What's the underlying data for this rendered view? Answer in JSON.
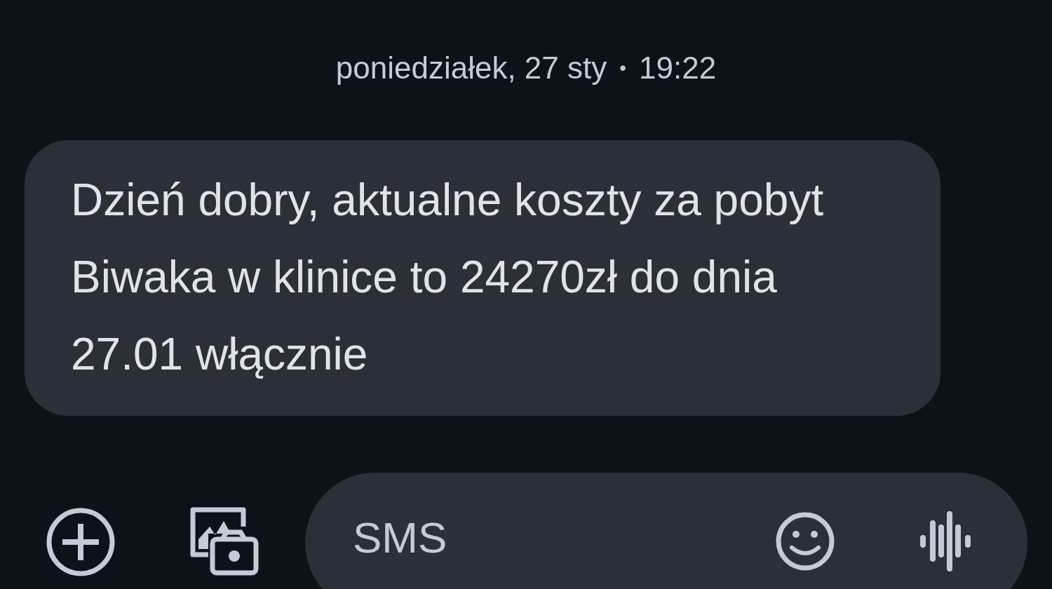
{
  "header": {
    "date": "poniedziałek, 27 sty",
    "separator": "•",
    "time": "19:22"
  },
  "messages": [
    {
      "text": "Dzień dobry, aktualne koszty za pobyt Biwaka w klinice to 24270zł do dnia 27.01 włącznie"
    }
  ],
  "compose": {
    "placeholder": "SMS"
  }
}
